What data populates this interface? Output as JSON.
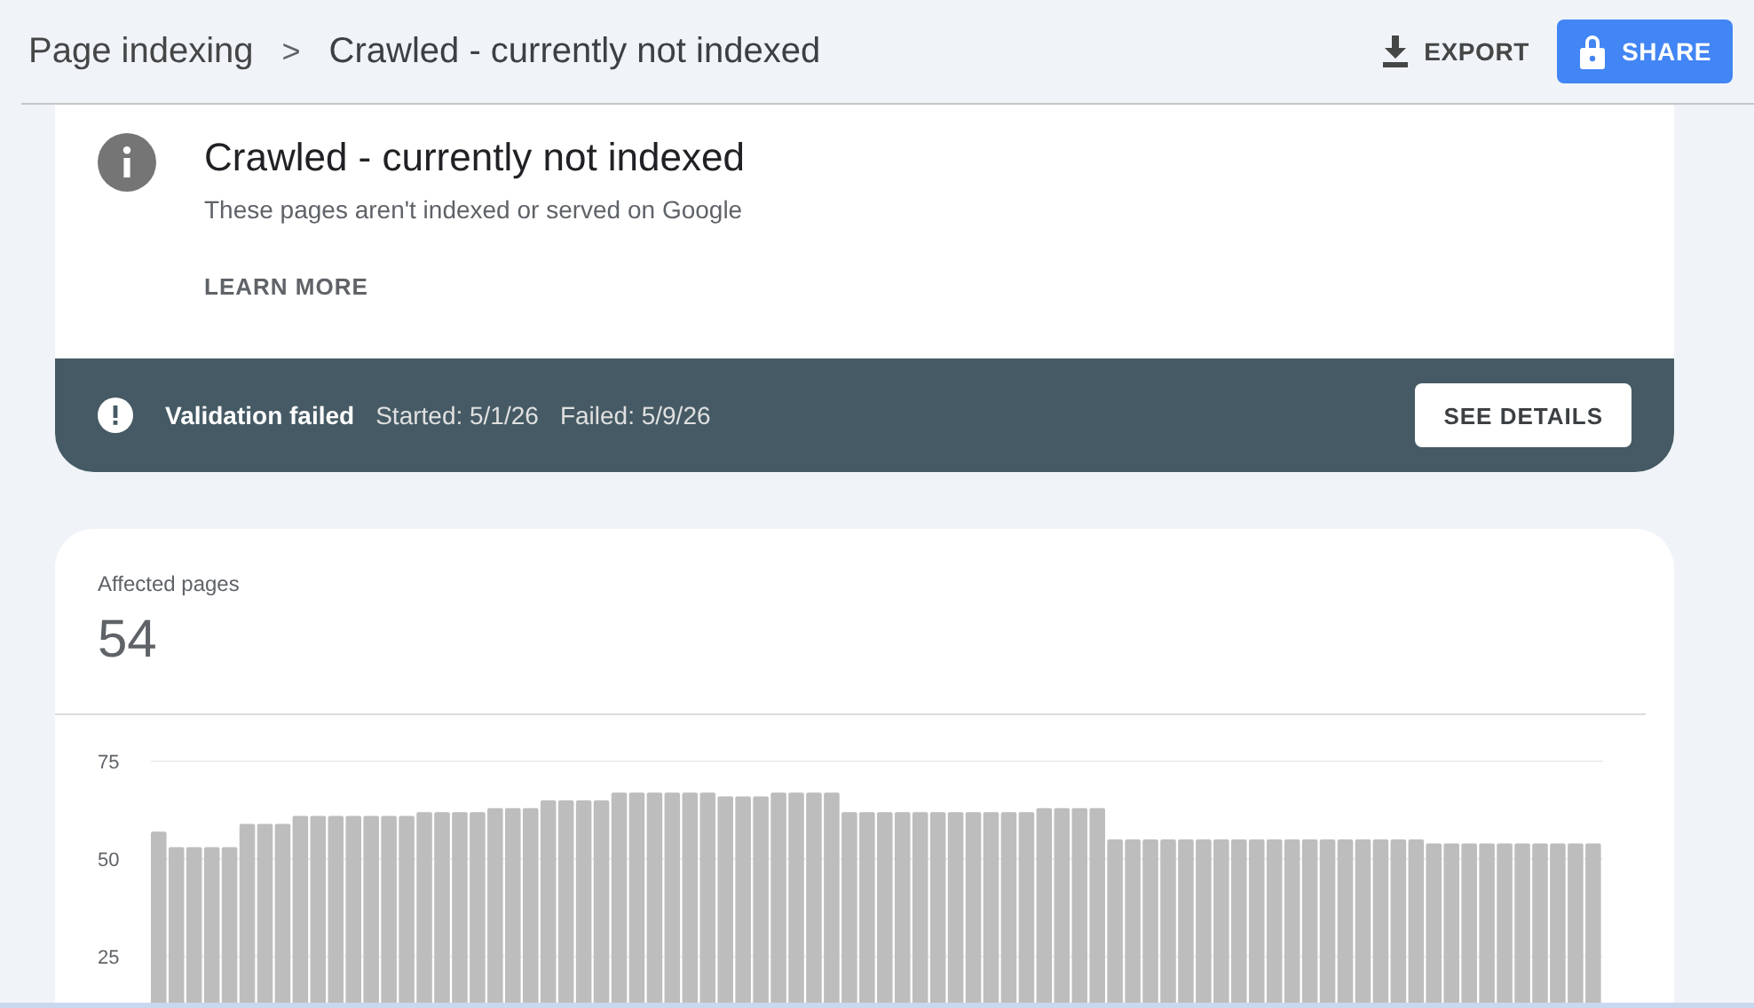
{
  "breadcrumb": {
    "parent": "Page indexing",
    "separator": ">",
    "current": "Crawled - currently not indexed"
  },
  "actions": [
    {
      "kind": "export",
      "label": "EXPORT"
    },
    {
      "kind": "share",
      "label": "SHARE"
    }
  ],
  "issue": {
    "title": "Crawled - currently not indexed",
    "description": "These pages aren't indexed or served on Google",
    "link": "LEARN MORE"
  },
  "validation": {
    "status": "Validation failed",
    "started": "Started: 5/1/26",
    "failed": "Failed: 5/9/26",
    "button": "SEE DETAILS"
  },
  "affected": {
    "label": "Affected pages",
    "value": "54",
    "chart_data": {
      "type": "bar",
      "ylim": [
        0,
        75
      ],
      "yticks": [
        25,
        50,
        75
      ],
      "series": [
        {
          "color": "#bdbdbd",
          "values": [
            57,
            53,
            53,
            53,
            53,
            59,
            59,
            59,
            61,
            61,
            61,
            61,
            61,
            61,
            61,
            62,
            62,
            62,
            62,
            63,
            63,
            63,
            65,
            65,
            65,
            65,
            67,
            67,
            67,
            67,
            67,
            67,
            66,
            66,
            66,
            67,
            67,
            67,
            67,
            62,
            62,
            62,
            62,
            62,
            62,
            62,
            62,
            62,
            62,
            62,
            63,
            63,
            63,
            63,
            55,
            55,
            55,
            55,
            55,
            55,
            55,
            55,
            55,
            55,
            55,
            55,
            55,
            55,
            55,
            55,
            55,
            55,
            54,
            54,
            54,
            54,
            54,
            54,
            54,
            54,
            54,
            54
          ]
        }
      ]
    }
  }
}
